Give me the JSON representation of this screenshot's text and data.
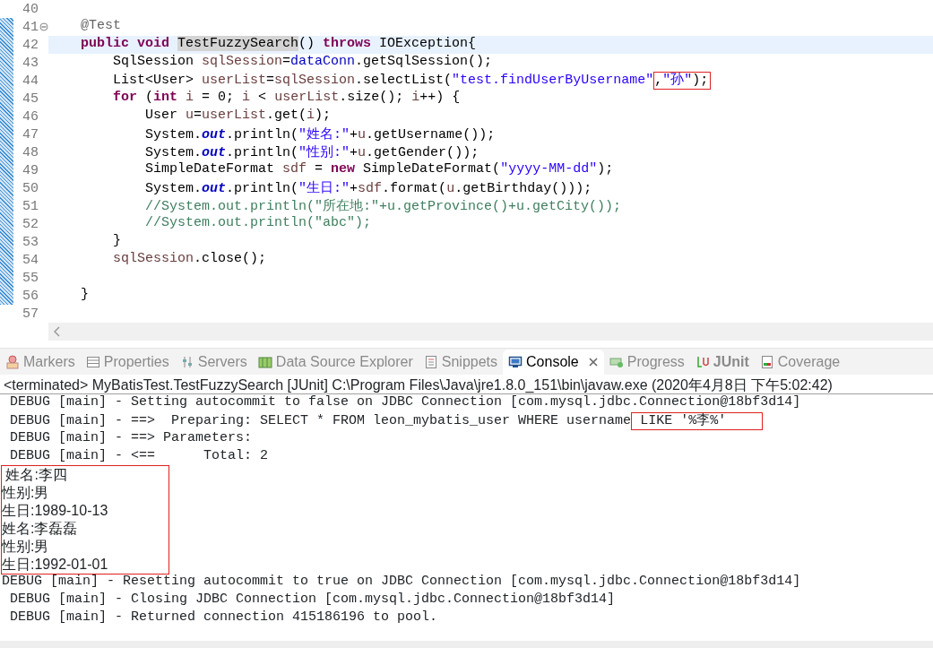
{
  "editor": {
    "lines": [
      {
        "number": "40",
        "current": false
      },
      {
        "number": "41",
        "current": false,
        "foldable": true,
        "tokens": [
          {
            "text": "    @Test",
            "kind": "annotation"
          }
        ]
      },
      {
        "number": "42",
        "current": true,
        "tokens": [
          {
            "text": "    public",
            "kind": "keyword"
          },
          {
            "text": " void ",
            "kind": "keyword"
          },
          {
            "text": "TestFuzzySearch",
            "occurrence": true
          },
          {
            "text": "() "
          },
          {
            "text": "throws",
            "kind": "keyword"
          },
          {
            "text": " IOException{"
          }
        ]
      },
      {
        "number": "43",
        "current": false,
        "tokens": [
          {
            "text": "        SqlSession "
          },
          {
            "text": "sqlSession",
            "kind": "local"
          },
          {
            "text": "="
          },
          {
            "text": "dataConn",
            "kind": "field"
          },
          {
            "text": ".getSqlSession();"
          }
        ]
      },
      {
        "number": "44",
        "current": false,
        "tokens": [
          {
            "text": "        List<User> "
          },
          {
            "text": "userList",
            "kind": "local"
          },
          {
            "text": "="
          },
          {
            "text": "sqlSession",
            "kind": "local"
          },
          {
            "text": ".selectList("
          },
          {
            "text": "\"test.findUserByUsername\"",
            "kind": "string"
          },
          {
            "text": ",",
            "highlight": true
          },
          {
            "text": "\"孙\"",
            "kind": "string",
            "highlight": true
          },
          {
            "text": ");",
            "highlight": true
          }
        ]
      },
      {
        "number": "45",
        "current": false,
        "tokens": [
          {
            "text": "        for",
            "kind": "keyword"
          },
          {
            "text": " ("
          },
          {
            "text": "int",
            "kind": "keyword"
          },
          {
            "text": " i",
            "kind": "local"
          },
          {
            "text": " = 0; "
          },
          {
            "text": "i",
            "kind": "local"
          },
          {
            "text": " < "
          },
          {
            "text": "userList",
            "kind": "local"
          },
          {
            "text": ".size(); "
          },
          {
            "text": "i",
            "kind": "local"
          },
          {
            "text": "++) {"
          }
        ]
      },
      {
        "number": "46",
        "current": false,
        "tokens": [
          {
            "text": "            User "
          },
          {
            "text": "u",
            "kind": "local"
          },
          {
            "text": "="
          },
          {
            "text": "userList",
            "kind": "local"
          },
          {
            "text": ".get("
          },
          {
            "text": "i",
            "kind": "local"
          },
          {
            "text": ");"
          }
        ]
      },
      {
        "number": "47",
        "current": false,
        "tokens": [
          {
            "text": "            System."
          },
          {
            "text": "out",
            "kind": "static"
          },
          {
            "text": ".println("
          },
          {
            "text": "\"姓名:\"",
            "kind": "string"
          },
          {
            "text": "+"
          },
          {
            "text": "u",
            "kind": "local"
          },
          {
            "text": ".getUsername());"
          }
        ]
      },
      {
        "number": "48",
        "current": false,
        "tokens": [
          {
            "text": "            System."
          },
          {
            "text": "out",
            "kind": "static"
          },
          {
            "text": ".println("
          },
          {
            "text": "\"性别:\"",
            "kind": "string"
          },
          {
            "text": "+"
          },
          {
            "text": "u",
            "kind": "local"
          },
          {
            "text": ".getGender());"
          }
        ]
      },
      {
        "number": "49",
        "current": false,
        "tokens": [
          {
            "text": "            SimpleDateFormat "
          },
          {
            "text": "sdf",
            "kind": "local"
          },
          {
            "text": " = "
          },
          {
            "text": "new",
            "kind": "keyword"
          },
          {
            "text": " SimpleDateFormat("
          },
          {
            "text": "\"yyyy-MM-dd\"",
            "kind": "string"
          },
          {
            "text": ");"
          }
        ]
      },
      {
        "number": "50",
        "current": false,
        "tokens": [
          {
            "text": "            System."
          },
          {
            "text": "out",
            "kind": "static"
          },
          {
            "text": ".println("
          },
          {
            "text": "\"生日:\"",
            "kind": "string"
          },
          {
            "text": "+"
          },
          {
            "text": "sdf",
            "kind": "local"
          },
          {
            "text": ".format("
          },
          {
            "text": "u",
            "kind": "local"
          },
          {
            "text": ".getBirthday()));"
          }
        ]
      },
      {
        "number": "51",
        "current": false,
        "tokens": [
          {
            "text": "            //System.out.println(\"所在地:\"+u.getProvince()+u.getCity());",
            "kind": "comment"
          }
        ]
      },
      {
        "number": "52",
        "current": false,
        "tokens": [
          {
            "text": "            //System.out.println(\"abc\");",
            "kind": "comment"
          }
        ]
      },
      {
        "number": "53",
        "current": false,
        "tokens": [
          {
            "text": "        }"
          }
        ]
      },
      {
        "number": "54",
        "current": false,
        "tokens": [
          {
            "text": "        sqlSession",
            "kind": "local"
          },
          {
            "text": ".close();"
          }
        ]
      },
      {
        "number": "55",
        "current": false
      },
      {
        "number": "56",
        "current": false,
        "tokens": [
          {
            "text": "    }"
          }
        ]
      },
      {
        "number": "57",
        "current": false
      }
    ]
  },
  "views": {
    "tabs": [
      {
        "label": "Markers",
        "selected": false,
        "emphasized": false
      },
      {
        "label": "Properties",
        "selected": false,
        "emphasized": false
      },
      {
        "label": "Servers",
        "selected": false,
        "emphasized": false
      },
      {
        "label": "Data Source Explorer",
        "selected": false,
        "emphasized": false
      },
      {
        "label": "Snippets",
        "selected": false,
        "emphasized": false
      },
      {
        "label": "Console",
        "selected": true,
        "emphasized": false
      },
      {
        "label": "Progress",
        "selected": false,
        "emphasized": false
      },
      {
        "label": "JUnit",
        "selected": false,
        "emphasized": true
      },
      {
        "label": "Coverage",
        "selected": false,
        "emphasized": false
      }
    ]
  },
  "console": {
    "header": "<terminated> MyBatisTest.TestFuzzySearch [JUnit] C:\\Program Files\\Java\\jre1.8.0_151\\bin\\javaw.exe (2020年4月8日 下午5:02:42)",
    "blocks": [
      {
        "kind": "log",
        "boxed": false,
        "lines": [
          [
            {
              "text": " DEBUG [main] - Setting autocommit to false on JDBC Connection [com.mysql.jdbc.Connection@18bf3d14]"
            }
          ],
          [
            {
              "text": " DEBUG [main] - ==>  Preparing: SELECT * FROM leon_mybatis_user WHERE username"
            },
            {
              "text": " LIKE '%李%'",
              "highlight": true
            }
          ],
          [
            {
              "text": " DEBUG [main] - ==> Parameters: "
            }
          ],
          [
            {
              "text": " DEBUG [main] - <==      Total: 2"
            }
          ]
        ]
      },
      {
        "kind": "output",
        "boxed": true,
        "lines": [
          [
            {
              "text": " 姓名:李四"
            }
          ],
          [
            {
              "text": "性别:男"
            }
          ],
          [
            {
              "text": "生日:1989-10-13"
            }
          ],
          [
            {
              "text": "姓名:李磊磊"
            }
          ],
          [
            {
              "text": "性别:男"
            }
          ],
          [
            {
              "text": "生日:1992-01-01"
            }
          ]
        ]
      },
      {
        "kind": "log",
        "boxed": false,
        "lines": [
          [
            {
              "text": "DEBUG [main] - Resetting autocommit to true on JDBC Connection [com.mysql.jdbc.Connection@18bf3d14]"
            }
          ],
          [
            {
              "text": " DEBUG [main] - Closing JDBC Connection [com.mysql.jdbc.Connection@18bf3d14]"
            }
          ],
          [
            {
              "text": " DEBUG [main] - Returned connection 415186196 to pool."
            }
          ]
        ]
      }
    ]
  }
}
